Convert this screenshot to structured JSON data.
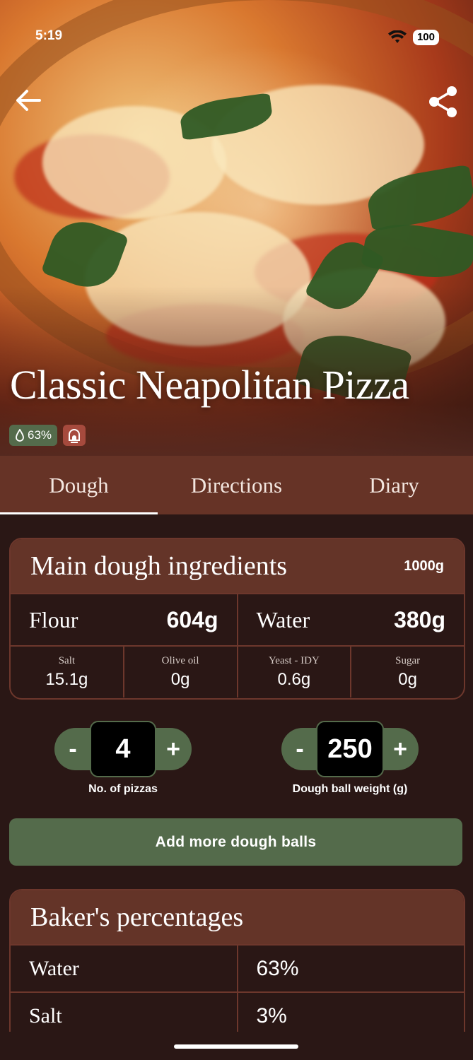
{
  "status_bar": {
    "time": "5:19",
    "battery": "100"
  },
  "recipe": {
    "title": "Classic Neapolitan Pizza",
    "hydration_chip": "63%"
  },
  "tabs": [
    {
      "label": "Dough",
      "active": true
    },
    {
      "label": "Directions",
      "active": false
    },
    {
      "label": "Diary",
      "active": false
    }
  ],
  "ingredients": {
    "title": "Main dough ingredients",
    "total": "1000g",
    "flour": {
      "label": "Flour",
      "value": "604g"
    },
    "water": {
      "label": "Water",
      "value": "380g"
    },
    "minor": [
      {
        "label": "Salt",
        "value": "15.1g"
      },
      {
        "label": "Olive oil",
        "value": "0g"
      },
      {
        "label": "Yeast - IDY",
        "value": "0.6g"
      },
      {
        "label": "Sugar",
        "value": "0g"
      }
    ]
  },
  "steppers": {
    "pizzas": {
      "minus": "-",
      "value": "4",
      "plus": "+",
      "label": "No. of pizzas"
    },
    "ball_weight": {
      "minus": "-",
      "value": "250",
      "plus": "+",
      "label": "Dough ball weight (g)"
    }
  },
  "add_button": "Add more dough balls",
  "percentages": {
    "title": "Baker's percentages",
    "rows": [
      {
        "label": "Water",
        "value": "63%"
      },
      {
        "label": "Salt",
        "value": "3%"
      }
    ]
  },
  "colors": {
    "background": "#2a1715",
    "header_brown": "#643428",
    "green": "#546b4b",
    "oven_chip": "#a64a3d"
  }
}
